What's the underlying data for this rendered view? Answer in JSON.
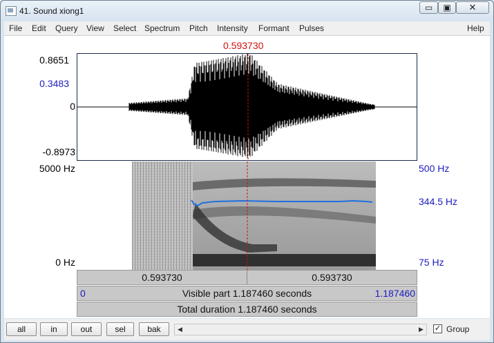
{
  "window": {
    "title": "41. Sound xiong1",
    "minimize_label": "▭",
    "maximize_label": "▣",
    "close_label": "✕"
  },
  "menu": [
    "File",
    "Edit",
    "Query",
    "View",
    "Select",
    "Spectrum",
    "Pitch",
    "Intensity",
    "Formant",
    "Pulses",
    "Help"
  ],
  "cursor": {
    "time_label": "0.593730"
  },
  "waveform": {
    "max_label": "0.8651",
    "cursor_value_label": "0.3483",
    "zero_label": "0",
    "min_label": "-0.8973"
  },
  "spectrogram": {
    "top_freq_label": "5000 Hz",
    "bottom_freq_label": "0 Hz",
    "pitch_top_label": "500 Hz",
    "pitch_value_label": "344.5 Hz",
    "pitch_bottom_label": "75 Hz"
  },
  "selection_bar": {
    "left_label": "0.593730",
    "right_label": "0.593730"
  },
  "visible_bar": {
    "start_label": "0",
    "text": "Visible part 1.187460 seconds",
    "end_label": "1.187460"
  },
  "total_bar": {
    "text": "Total duration 1.187460 seconds"
  },
  "buttons": {
    "all": "all",
    "in": "in",
    "out": "out",
    "sel": "sel",
    "bak": "bak"
  },
  "group": {
    "label": "Group",
    "checked": true,
    "check_mark": "✓"
  },
  "colors": {
    "cursor_red": "#d01010",
    "pitch_blue": "#1c1cc0",
    "pitch_line": "#1f6fe0"
  }
}
